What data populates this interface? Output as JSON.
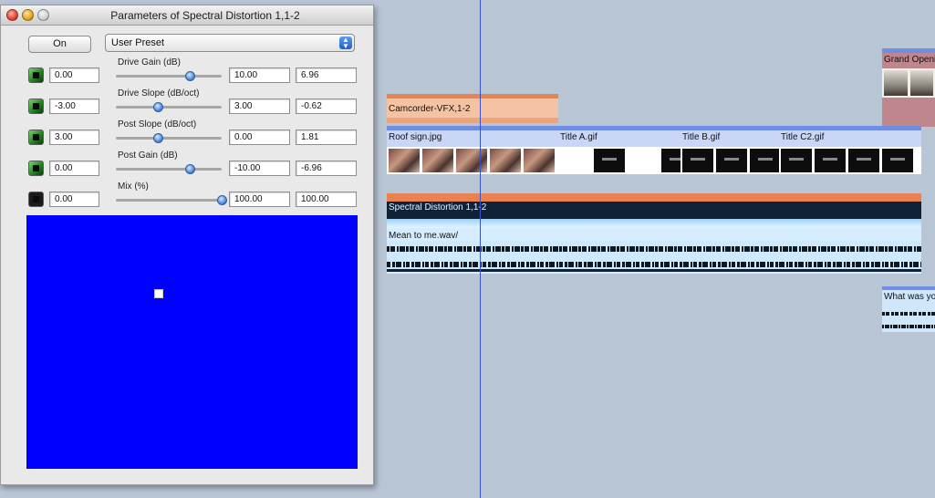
{
  "window": {
    "title": "Parameters of Spectral Distortion 1,1-2",
    "on_button": "On",
    "preset": "User Preset",
    "parameters": [
      {
        "label": "Drive Gain (dB)",
        "min": "0.00",
        "max": "10.00",
        "value": "6.96",
        "slider_fraction": 0.696,
        "enabled": true
      },
      {
        "label": "Drive Slope (dB/oct)",
        "min": "-3.00",
        "max": "3.00",
        "value": "-0.62",
        "slider_fraction": 0.4,
        "enabled": true
      },
      {
        "label": "Post Slope (dB/oct)",
        "min": "3.00",
        "max": "0.00",
        "value": "1.81",
        "slider_fraction": 0.4,
        "enabled": true
      },
      {
        "label": "Post Gain (dB)",
        "min": "0.00",
        "max": "-10.00",
        "value": "-6.96",
        "slider_fraction": 0.696,
        "enabled": true
      },
      {
        "label": "Mix (%)",
        "min": "0.00",
        "max": "100.00",
        "value": "100.00",
        "slider_fraction": 1.0,
        "enabled": false
      }
    ],
    "display_color": "#0000ff"
  },
  "timeline": {
    "clips": {
      "camcorder": "Camcorder-VFX,1-2",
      "roof_sign": "Roof sign.jpg",
      "title_a": "Title A.gif",
      "title_b": "Title B.gif",
      "title_c2": "Title C2.gif",
      "spectral": "Spectral Distortion 1,1-2",
      "audio": "Mean to me.wav/",
      "grand_opening": "Grand Opening",
      "what_was": "What was yo"
    }
  }
}
